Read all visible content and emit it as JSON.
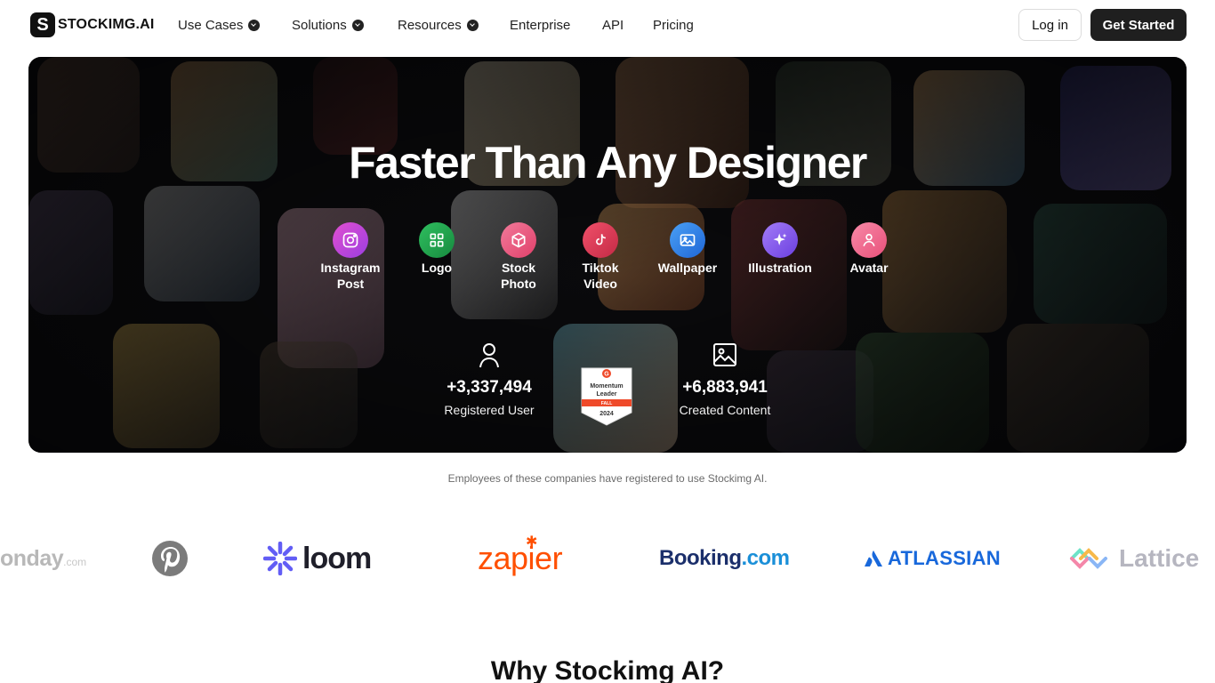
{
  "brand": {
    "mark": "S",
    "name": "STOCKIMG.AI"
  },
  "nav": {
    "items": [
      {
        "label": "Use Cases",
        "dropdown": true
      },
      {
        "label": "Solutions",
        "dropdown": true
      },
      {
        "label": "Resources",
        "dropdown": true
      },
      {
        "label": "Enterprise",
        "dropdown": false
      },
      {
        "label": "API",
        "dropdown": false
      },
      {
        "label": "Pricing",
        "dropdown": false
      }
    ],
    "login": "Log in",
    "get_started": "Get Started"
  },
  "hero": {
    "title": "Faster Than Any Designer",
    "categories": [
      {
        "label": "Instagram Post",
        "icon": "instagram-icon",
        "color": "#c93bd6"
      },
      {
        "label": "Logo",
        "icon": "grid-icon",
        "color": "#22a14f"
      },
      {
        "label": "Stock Photo",
        "icon": "box-icon",
        "color": "#e9557a"
      },
      {
        "label": "Tiktok Video",
        "icon": "tiktok-icon",
        "color": "#e2334f"
      },
      {
        "label": "Wallpaper",
        "icon": "image-icon",
        "color": "#2f7fe6"
      },
      {
        "label": "Illustration",
        "icon": "sparkle-icon",
        "color": "#8b5cf6"
      },
      {
        "label": "Avatar",
        "icon": "user-icon",
        "color": "#f0678f"
      }
    ],
    "stats": [
      {
        "value": "+3,337,494",
        "label": "Registered User",
        "icon": "user-outline-icon"
      },
      {
        "value": "+6,883,941",
        "label": "Created Content",
        "icon": "image-outline-icon"
      }
    ],
    "badge": {
      "lines": [
        "Momentum",
        "Leader",
        "FALL",
        "2024"
      ]
    }
  },
  "companies": {
    "note": "Employees of these companies have registered to use Stockimg AI.",
    "logos": [
      {
        "name": "onday.com",
        "text": "onday",
        "suffix": ".com"
      },
      {
        "name": "pinterest",
        "text": ""
      },
      {
        "name": "loom",
        "text": "loom"
      },
      {
        "name": "zapier",
        "text": "zapier"
      },
      {
        "name": "booking",
        "text": "Booking",
        "suffix": ".com"
      },
      {
        "name": "atlassian",
        "text": "ATLASSIAN"
      },
      {
        "name": "lattice",
        "text": "Lattice"
      }
    ]
  },
  "section": {
    "why_title": "Why Stockimg AI?"
  }
}
